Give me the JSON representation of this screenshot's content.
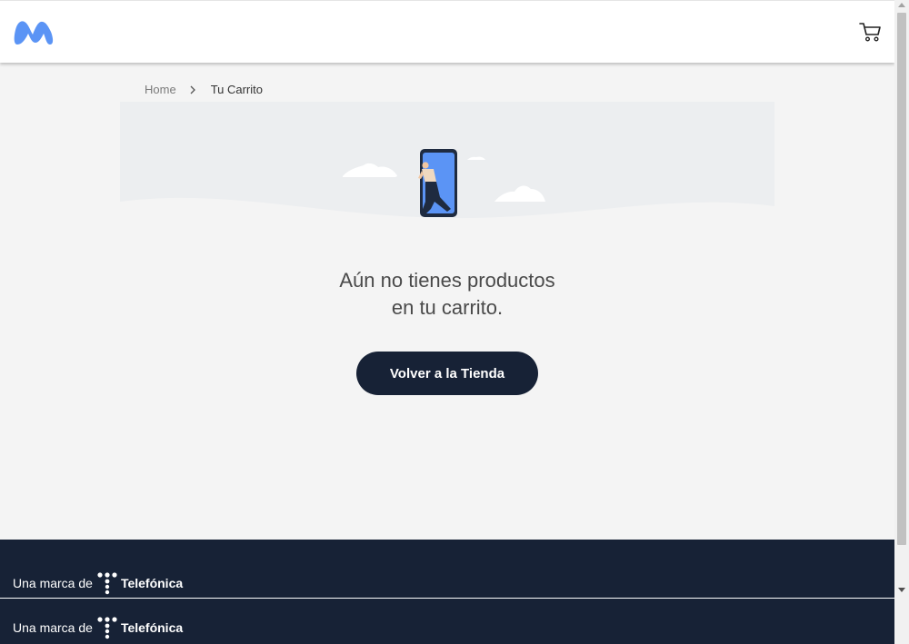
{
  "header": {
    "logo_icon": "movistar-logo-icon",
    "cart_icon": "shopping-cart-icon",
    "brand_color": "#5b94f5"
  },
  "breadcrumb": {
    "home": "Home",
    "separator_icon": "chevron-right-icon",
    "current": "Tu Carrito"
  },
  "banner": {
    "illustration": "person-walking-out-of-phone-illustration"
  },
  "empty_cart": {
    "line1": "Aún no tienes productos",
    "line2": "en tu carrito.",
    "button_label": "Volver a la Tienda",
    "button_color": "#172236"
  },
  "footer": {
    "rows": [
      {
        "prefix": "Una marca de",
        "brand": "Telefónica"
      },
      {
        "prefix": "Una marca de",
        "brand": "Telefónica"
      }
    ],
    "background": "#172236"
  }
}
